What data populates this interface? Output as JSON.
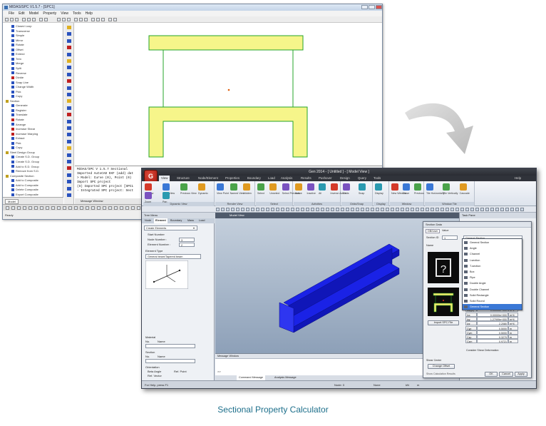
{
  "caption": "Sectional Property Calculator",
  "window1": {
    "title": "MIDAS/SPC V1.5.7 - [SPC1]",
    "menu": [
      "File",
      "Edit",
      "Model",
      "Property",
      "View",
      "Tools",
      "Help"
    ],
    "tree": [
      {
        "label": "Closed Loop",
        "color": "#2a52be"
      },
      {
        "label": "Transverse",
        "color": "#2a52be"
      },
      {
        "label": "Simple",
        "color": "#2a52be"
      },
      {
        "label": "Mirror",
        "color": "#2a52be"
      },
      {
        "label": "Rotate",
        "color": "#2a52be"
      },
      {
        "label": "Offset",
        "color": "#2a52be"
      },
      {
        "label": "Extend",
        "color": "#2a52be"
      },
      {
        "label": "Trim",
        "color": "#2a52be"
      },
      {
        "label": "Merge",
        "color": "#2a52be"
      },
      {
        "label": "Split",
        "color": "#2a52be"
      },
      {
        "label": "Reverse",
        "color": "#2a52be"
      },
      {
        "label": "Divide",
        "color": "#c02020"
      },
      {
        "label": "Snap Line",
        "color": "#2a52be"
      },
      {
        "label": "Change Width",
        "color": "#2a52be"
      },
      {
        "label": "Pick",
        "color": "#2a52be"
      },
      {
        "label": "Copy",
        "color": "#2a52be"
      },
      {
        "label": "Section",
        "color": "#c0a020"
      },
      {
        "label": "Generate",
        "color": "#2a52be"
      },
      {
        "label": "Register",
        "color": "#2a52be"
      },
      {
        "label": "Translate",
        "color": "#2a52be"
      },
      {
        "label": "Rotate",
        "color": "#c02020"
      },
      {
        "label": "Arrange",
        "color": "#2a52be"
      },
      {
        "label": "Increase Shear",
        "color": "#c02020"
      },
      {
        "label": "Increase Warping",
        "color": "#c02020"
      },
      {
        "label": "Extract",
        "color": "#2a52be"
      },
      {
        "label": "Pick",
        "color": "#2a52be"
      },
      {
        "label": "Copy",
        "color": "#2a52be"
      },
      {
        "label": "Steel Design Group",
        "color": "#c0a020"
      },
      {
        "label": "Create S.D. Group",
        "color": "#2a52be"
      },
      {
        "label": "Create S.D. Group",
        "color": "#2a52be"
      },
      {
        "label": "Add to S.D. Group",
        "color": "#2a52be"
      },
      {
        "label": "Remove from S.D.",
        "color": "#2a52be"
      },
      {
        "label": "Composite Section",
        "color": "#c0a020"
      },
      {
        "label": "Add to Composite",
        "color": "#2a52be"
      },
      {
        "label": "Add to Composite",
        "color": "#2a52be"
      },
      {
        "label": "Delete Composite",
        "color": "#2a52be"
      },
      {
        "label": "Export Composite",
        "color": "#2a52be"
      }
    ],
    "tree_tab": "Model",
    "messages": [
      "MIDAS/SPC V 1.5.7   Sectional",
      "Imported AutoCAD DXF (add) dat",
      "> Model: Curve (0), Point (0)",
      "Import SPC project",
      "(S) Imported SPC project [SPC1",
      "- Integrated SPC project: Sect"
    ],
    "message_tab": "Message Window",
    "status": "Ready",
    "section_color": "#f6f58a",
    "section_outline": "#24a42a"
  },
  "window2": {
    "title": "Gen 2014 - [ Untitled ] - [ Model View ]",
    "app_letter": "G",
    "tabs": [
      "View",
      "Structure",
      "Node/Element",
      "Properties",
      "Boundary",
      "Load",
      "Analysis",
      "Results",
      "Pushover",
      "Design",
      "Query",
      "Tools"
    ],
    "active_tab": "View",
    "help_label": "Help",
    "ribbon_groups": [
      {
        "label": "Dynamic View",
        "items": [
          "Redraw",
          "Initial View",
          "Previous View",
          "Dynamic",
          "Zoom",
          "Pan"
        ]
      },
      {
        "label": "Render View",
        "items": [
          "View Point",
          "Named View",
          "Hidden"
        ]
      },
      {
        "label": "Select",
        "items": [
          "Select",
          "Unselect",
          "Select Previous"
        ]
      },
      {
        "label": "Activities",
        "items": [
          "Active",
          "Inactive",
          "All",
          "Inverse Active"
        ]
      },
      {
        "label": "Grids/Snap",
        "items": [
          "Grids",
          "Snap"
        ]
      },
      {
        "label": "Display",
        "items": [
          "Display"
        ]
      },
      {
        "label": "Window",
        "items": [
          "New Window",
          "Close",
          "Previous"
        ]
      },
      {
        "label": "Window Tile",
        "items": [
          "Tile Horizontally",
          "Tile Vertically",
          "Cascade"
        ]
      }
    ],
    "left_panel": {
      "title": "Tree Menu",
      "tabs": [
        "Node",
        "Element",
        "Boundary",
        "Mass",
        "Load"
      ],
      "active_tab": "Element",
      "command": "Create Elements",
      "start_number": "Start Number",
      "node_number_label": "Node Number :",
      "node_number": "3",
      "element_number_label": "Element Number :",
      "element_number": "2",
      "element_type_label": "Element Type",
      "element_type": "General beam/Tapered beam",
      "material_label": "Material",
      "section_label": "Section",
      "no_label": "No.",
      "name_label": "Name",
      "orientation_label": "Orientation",
      "beta_angle": "Beta Angle",
      "ref_point": "Ref. Point",
      "ref_vector": "Ref. Vector"
    },
    "model_view": {
      "caption": "Model View",
      "beam_color": "#1a22e6",
      "background_top": "#c4cfdc",
      "background_bottom": "#8da0b8"
    },
    "message": {
      "caption": "Message Window",
      "tabs": [
        "Command Message",
        "Analysis Message"
      ],
      "prompt": ">>"
    },
    "right_panel": {
      "title": "Task Pane"
    },
    "status": {
      "text": "For Help, press F1",
      "node": "Node: 3",
      "none": "None",
      "unit1": "kN",
      "unit2": "m"
    },
    "section_dialog": {
      "title": "Section Data",
      "tabs": [
        "DB/User",
        "Value"
      ],
      "section_id_label": "Section ID",
      "section_id": "1",
      "name_label": "Name",
      "type_value": "General Section",
      "import_button": "Import SPC File",
      "shear_label": "Shear Center",
      "shear_value": "Offset: Center-Center",
      "change_offset_button": "Change Offset",
      "show_dimension": "Show Calculation Results",
      "ok": "OK",
      "cancel": "Cancel",
      "apply": "Apply",
      "calc_checkbox": "Consider Shear Deformation",
      "props": [
        {
          "k": "Area",
          "v": "0.1004",
          "u": "m^2"
        },
        {
          "k": "Asy(z)",
          "v": "0.00000e+000",
          "u": "m^2"
        },
        {
          "k": "Ixx",
          "v": "0.00000e+000",
          "u": "m^4"
        },
        {
          "k": "Iyy",
          "v": "1.27999e+000",
          "u": "m^4"
        },
        {
          "k": "Izz",
          "v": "2.2080",
          "u": "m^4"
        },
        {
          "k": "Cyp",
          "v": "0.5000",
          "u": "m"
        },
        {
          "k": "Cym",
          "v": "0.5000",
          "u": "m"
        },
        {
          "k": "Czp",
          "v": "0.3279",
          "u": "m"
        },
        {
          "k": "Czm",
          "v": "0.9721",
          "u": "m"
        }
      ],
      "dropdown": [
        {
          "label": "General Section",
          "sel": false
        },
        {
          "label": "Angle",
          "sel": false
        },
        {
          "label": "Channel",
          "sel": false
        },
        {
          "label": "I-section",
          "sel": false
        },
        {
          "label": "T-section",
          "sel": false
        },
        {
          "label": "Box",
          "sel": false
        },
        {
          "label": "Pipe",
          "sel": false
        },
        {
          "label": "Double Angle",
          "sel": false
        },
        {
          "label": "Double Channel",
          "sel": false
        },
        {
          "label": "Solid Rectangle",
          "sel": false
        },
        {
          "label": "Solid Round",
          "sel": false
        },
        {
          "label": "General Section",
          "sel": true
        }
      ]
    }
  }
}
